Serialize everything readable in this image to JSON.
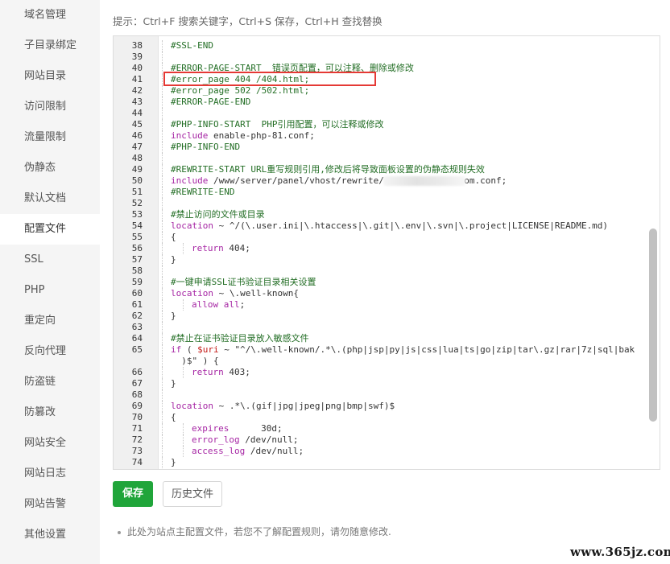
{
  "sidebar": {
    "items": [
      {
        "label": "域名管理",
        "active": false
      },
      {
        "label": "子目录绑定",
        "active": false
      },
      {
        "label": "网站目录",
        "active": false
      },
      {
        "label": "访问限制",
        "active": false
      },
      {
        "label": "流量限制",
        "active": false
      },
      {
        "label": "伪静态",
        "active": false
      },
      {
        "label": "默认文档",
        "active": false
      },
      {
        "label": "配置文件",
        "active": true
      },
      {
        "label": "SSL",
        "active": false
      },
      {
        "label": "PHP",
        "active": false
      },
      {
        "label": "重定向",
        "active": false
      },
      {
        "label": "反向代理",
        "active": false
      },
      {
        "label": "防盗链",
        "active": false
      },
      {
        "label": "防篡改",
        "active": false
      },
      {
        "label": "网站安全",
        "active": false
      },
      {
        "label": "网站日志",
        "active": false
      },
      {
        "label": "网站告警",
        "active": false
      },
      {
        "label": "其他设置",
        "active": false
      }
    ]
  },
  "hint": "提示：Ctrl+F 搜索关键字，Ctrl+S 保存，Ctrl+H 查找替换",
  "editor": {
    "lines": [
      {
        "n": "38",
        "indent": 1,
        "parts": [
          {
            "t": "#SSL-END",
            "c": "com"
          }
        ]
      },
      {
        "n": "39",
        "indent": 1,
        "parts": []
      },
      {
        "n": "40",
        "indent": 1,
        "parts": [
          {
            "t": "#ERROR-PAGE-START  错误页配置，可以注释、删除或修改",
            "c": "com"
          }
        ]
      },
      {
        "n": "41",
        "indent": 1,
        "parts": [
          {
            "t": "#error_page 404 /404.html;",
            "c": "com"
          }
        ]
      },
      {
        "n": "42",
        "indent": 1,
        "parts": [
          {
            "t": "#error_page 502 /502.html;",
            "c": "com"
          }
        ]
      },
      {
        "n": "43",
        "indent": 1,
        "parts": [
          {
            "t": "#ERROR-PAGE-END",
            "c": "com"
          }
        ]
      },
      {
        "n": "44",
        "indent": 1,
        "parts": []
      },
      {
        "n": "45",
        "indent": 1,
        "parts": [
          {
            "t": "#PHP-INFO-START  PHP引用配置，可以注释或修改",
            "c": "com"
          }
        ]
      },
      {
        "n": "46",
        "indent": 1,
        "parts": [
          {
            "t": "include",
            "c": "kw"
          },
          {
            "t": " enable-php-81.conf;",
            "c": ""
          }
        ]
      },
      {
        "n": "47",
        "indent": 1,
        "parts": [
          {
            "t": "#PHP-INFO-END",
            "c": "com"
          }
        ]
      },
      {
        "n": "48",
        "indent": 1,
        "parts": []
      },
      {
        "n": "49",
        "indent": 1,
        "parts": [
          {
            "t": "#REWRITE-START URL重写规则引用,修改后将导致面板设置的伪静态规则失效",
            "c": "com"
          }
        ]
      },
      {
        "n": "50",
        "indent": 1,
        "parts": [
          {
            "t": "include",
            "c": "kw"
          },
          {
            "t": " /www/server/panel/vhost/rewrite/               om.conf;",
            "c": ""
          }
        ]
      },
      {
        "n": "51",
        "indent": 1,
        "parts": [
          {
            "t": "#REWRITE-END",
            "c": "com"
          }
        ]
      },
      {
        "n": "52",
        "indent": 1,
        "parts": []
      },
      {
        "n": "53",
        "indent": 1,
        "parts": [
          {
            "t": "#禁止访问的文件或目录",
            "c": "com"
          }
        ]
      },
      {
        "n": "54",
        "indent": 1,
        "parts": [
          {
            "t": "location",
            "c": "kw"
          },
          {
            "t": " ~ ^/(\\.user.ini|\\.htaccess|\\.git|\\.env|\\.svn|\\.project|LICENSE|README.md)",
            "c": ""
          }
        ]
      },
      {
        "n": "55",
        "indent": 1,
        "parts": [
          {
            "t": "{",
            "c": ""
          }
        ]
      },
      {
        "n": "56",
        "indent": 2,
        "parts": [
          {
            "t": "return",
            "c": "kw"
          },
          {
            "t": " 404;",
            "c": ""
          }
        ]
      },
      {
        "n": "57",
        "indent": 1,
        "parts": [
          {
            "t": "}",
            "c": ""
          }
        ]
      },
      {
        "n": "58",
        "indent": 1,
        "parts": []
      },
      {
        "n": "59",
        "indent": 1,
        "parts": [
          {
            "t": "#一键申请SSL证书验证目录相关设置",
            "c": "com"
          }
        ]
      },
      {
        "n": "60",
        "indent": 1,
        "parts": [
          {
            "t": "location",
            "c": "kw"
          },
          {
            "t": " ~ \\.well-known{",
            "c": ""
          }
        ]
      },
      {
        "n": "61",
        "indent": 2,
        "parts": [
          {
            "t": "allow",
            "c": "kw"
          },
          {
            "t": " ",
            "c": ""
          },
          {
            "t": "all",
            "c": "kw"
          },
          {
            "t": ";",
            "c": ""
          }
        ]
      },
      {
        "n": "62",
        "indent": 1,
        "parts": [
          {
            "t": "}",
            "c": ""
          }
        ]
      },
      {
        "n": "63",
        "indent": 1,
        "parts": []
      },
      {
        "n": "64",
        "indent": 1,
        "parts": [
          {
            "t": "#禁止在证书验证目录放入敏感文件",
            "c": "com"
          }
        ]
      },
      {
        "n": "65",
        "indent": 1,
        "parts": [
          {
            "t": "if",
            "c": "kw"
          },
          {
            "t": " ( ",
            "c": ""
          },
          {
            "t": "$uri",
            "c": "var"
          },
          {
            "t": " ~ \"^/\\.well-known/.*\\.(php|jsp|py|js|css|lua|ts|go|zip|tar\\.gz|rar|7z|sql|bak",
            "c": ""
          }
        ]
      },
      {
        "n": "",
        "indent": 1,
        "parts": [
          {
            "t": "  )$\" ) {",
            "c": ""
          }
        ]
      },
      {
        "n": "66",
        "indent": 2,
        "parts": [
          {
            "t": "return",
            "c": "kw"
          },
          {
            "t": " 403;",
            "c": ""
          }
        ]
      },
      {
        "n": "67",
        "indent": 1,
        "parts": [
          {
            "t": "}",
            "c": ""
          }
        ]
      },
      {
        "n": "68",
        "indent": 1,
        "parts": []
      },
      {
        "n": "69",
        "indent": 1,
        "parts": [
          {
            "t": "location",
            "c": "kw"
          },
          {
            "t": " ~ .*\\.(gif|jpg|jpeg|png|bmp|swf)$",
            "c": ""
          }
        ]
      },
      {
        "n": "70",
        "indent": 1,
        "parts": [
          {
            "t": "{",
            "c": ""
          }
        ]
      },
      {
        "n": "71",
        "indent": 2,
        "parts": [
          {
            "t": "expires",
            "c": "kw"
          },
          {
            "t": "      30d;",
            "c": ""
          }
        ]
      },
      {
        "n": "72",
        "indent": 2,
        "parts": [
          {
            "t": "error_log",
            "c": "kw"
          },
          {
            "t": " /dev/null;",
            "c": ""
          }
        ]
      },
      {
        "n": "73",
        "indent": 2,
        "parts": [
          {
            "t": "access_log",
            "c": "kw"
          },
          {
            "t": " /dev/null;",
            "c": ""
          }
        ]
      },
      {
        "n": "74",
        "indent": 1,
        "parts": [
          {
            "t": "}",
            "c": ""
          }
        ]
      }
    ]
  },
  "buttons": {
    "save": "保存",
    "history": "历史文件"
  },
  "note": "此处为站点主配置文件，若您不了解配置规则，请勿随意修改.",
  "watermark": "www.365jz.com"
}
